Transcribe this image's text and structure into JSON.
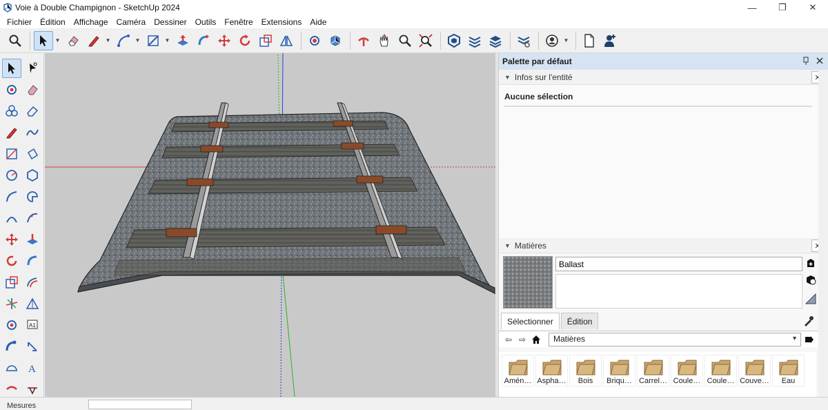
{
  "window": {
    "title": "Voie à Double Champignon - SketchUp 2024",
    "minimize": "—",
    "maximize": "❐",
    "close": "✕"
  },
  "menu": [
    "Fichier",
    "Édition",
    "Affichage",
    "Caméra",
    "Dessiner",
    "Outils",
    "Fenêtre",
    "Extensions",
    "Aide"
  ],
  "toolbar": {
    "active_tool": "select-icon",
    "icons": [
      "search-icon",
      "select-icon",
      "eraser-icon",
      "pencil-icon",
      "arc-icon",
      "rectangle-icon",
      "push-pull-icon",
      "follow-me-icon",
      "move-icon",
      "rotate-icon",
      "scale-icon",
      "offset-icon",
      "paint-bucket-icon",
      "orbit-icon",
      "pan-icon",
      "zoom-icon",
      "zoom-extents-icon",
      "section-plane-icon",
      "layers-icon",
      "warehouse-icon",
      "extension-icon",
      "account-icon",
      "new-file-icon",
      "user-icon"
    ]
  },
  "left_tools": {
    "active_tool": "select-icon",
    "icons": [
      "select-icon",
      "lasso-icon",
      "paint-icon",
      "eraser-icon",
      "components-icon",
      "tag-eraser-icon",
      "pencil-icon",
      "freehand-icon",
      "rectangle-icon",
      "rotated-rectangle-icon",
      "circle-icon",
      "polygon-icon",
      "arc-icon",
      "pie-icon",
      "two-point-arc-icon",
      "three-point-arc-icon",
      "move-icon",
      "push-pull-icon",
      "rotate-icon",
      "follow-me-icon",
      "scale-icon",
      "offset-icon",
      "axes-icon",
      "protractor-icon",
      "paint-bucket-icon",
      "text-icon",
      "tape-measure-icon",
      "dimension-icon",
      "protractor-2-icon",
      "3d-text-icon",
      "walk-icon",
      "look-around-icon"
    ]
  },
  "panel": {
    "title": "Palette par défaut",
    "entity_info": {
      "heading": "Infos sur l'entité",
      "selection": "Aucune sélection"
    },
    "materials": {
      "heading": "Matières",
      "name": "Ballast",
      "tab_select": "Sélectionner",
      "tab_edit": "Édition",
      "library": "Matières",
      "items": [
        "Amén…",
        "Aspha…",
        "Bois",
        "Briqu…",
        "Carrel…",
        "Coule…",
        "Coule…",
        "Couve…",
        "Eau"
      ]
    }
  },
  "status": {
    "label": "Mesures"
  },
  "colors": {
    "accent": "#cfe3f7",
    "panel_header": "#d5e3f2",
    "axis_red": "#d83a3a",
    "axis_green": "#2bb12b",
    "axis_blue": "#2a3fd8"
  }
}
